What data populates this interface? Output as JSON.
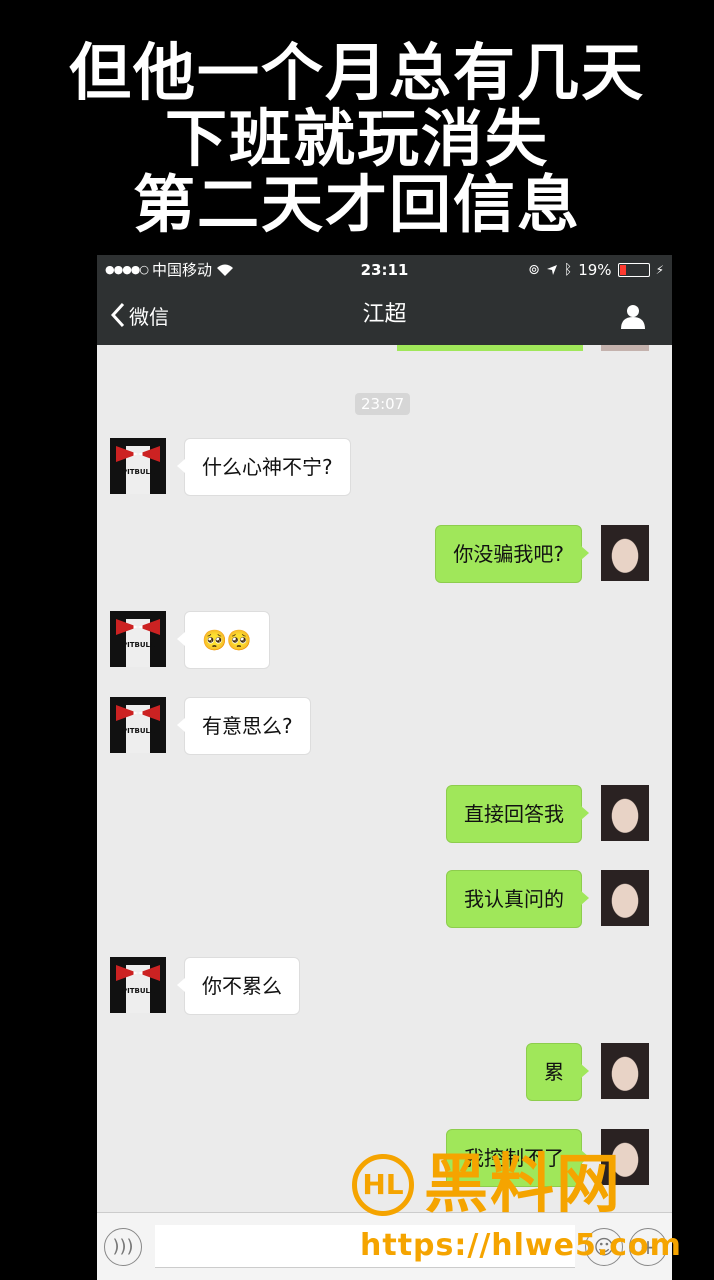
{
  "caption": {
    "line1": "但他一个月总有几天",
    "line2": "下班就玩消失",
    "line3": "第二天才回信息"
  },
  "status_bar": {
    "signal": "●●●●○",
    "carrier": "中国移动",
    "time": "23:11",
    "battery": "19%"
  },
  "nav": {
    "back_label": "微信",
    "title": "江超"
  },
  "timestamp": "23:07",
  "messages": [
    {
      "from": "other",
      "text": "什么心神不宁?"
    },
    {
      "from": "me",
      "text": "你没骗我吧?"
    },
    {
      "from": "other",
      "text": "🥺🥺"
    },
    {
      "from": "other",
      "text": "有意思么?"
    },
    {
      "from": "me",
      "text": "直接回答我"
    },
    {
      "from": "me",
      "text": "我认真问的"
    },
    {
      "from": "other",
      "text": "你不累么"
    },
    {
      "from": "me",
      "text": "累"
    },
    {
      "from": "me",
      "text": "我控制不了"
    }
  ],
  "avatar_other_logo": "PITBULL",
  "watermark": {
    "logo_text": "黑料网",
    "url": "https://hlwe5.com"
  },
  "colors": {
    "navbar": "#2e3132",
    "chat_bg": "#ebebeb",
    "outgoing_bubble": "#a0e75a",
    "incoming_bubble": "#ffffff",
    "watermark": "#f5a400"
  },
  "icons": [
    "wifi-icon",
    "location-icon",
    "bluetooth-icon",
    "battery-icon",
    "back-chevron-icon",
    "profile-icon",
    "voice-icon",
    "emoji-icon",
    "plus-icon"
  ]
}
